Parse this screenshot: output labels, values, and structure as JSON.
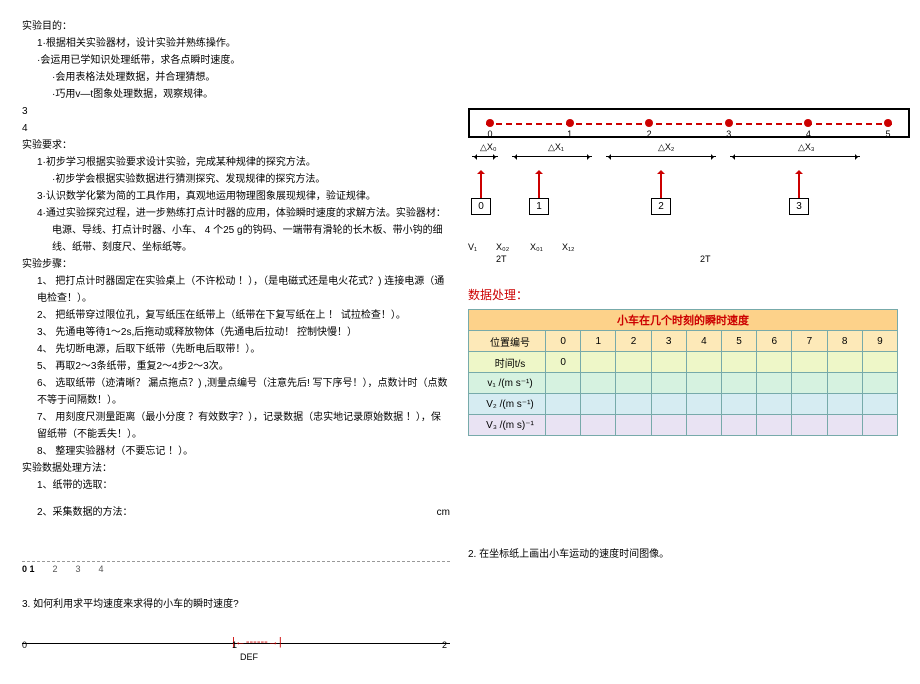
{
  "left": {
    "purpose_title": "实验目的：",
    "purpose_items": [
      "1·根据相关实验器材，设计实验并熟练操作。",
      "·会运用已学知识处理纸带，求各点瞬时速度。",
      "·会用表格法处理数据，并合理猜想。",
      "·巧用v—t图象处理数据，观察规律。"
    ],
    "nums": [
      "3",
      "4"
    ],
    "req_title": "实验要求：",
    "req_items": [
      "1·初步学习根据实验要求设计实验，完成某种规律的探究方法。",
      "·初步学会根据实验数据进行猜测探究、发现规律的探究方法。",
      "3·认识数学化繁为简的工具作用，真观地运用物理图象展现规律，验证规律。",
      "4·通过实验探究过程，进一步熟练打点计时器的应用，体验瞬时速度的求解方法。实验器材："
    ],
    "equip": "电源、导线、打点计时器、小车、 4 个25 g的钩码、一端带有滑轮的长木板、带小钩的细线、纸带、刻度尺、坐标纸等。",
    "steps_title": "实验步骤：",
    "steps": [
      "1、 把打点计时器固定在实验桌上（不许松动 ！），（是电磁式还是电火花式？) 连接电源（通电检查！）。",
      "2、 把纸带穿过限位孔，复写纸压在纸带上（纸带在下复写纸在上 ！ 试拉检查！）。",
      "3、 先通电等待1～2s,后拖动或释放物体（先通电后拉动！ 控制快慢！）",
      "4、 先切断电源，后取下纸带（先断电后取带！）。",
      "5、 再取2～3条纸带，重复2～4步2～3次。",
      "6、 选取纸带（迹清晰？ 漏点拖点？) ,测量点编号（注意先后! 写下序号！），点数计时（点数不等于间隔数！）。",
      "7、 用刻度尺测量距离（最小分度 ？有效数字？），记录数据（忠实地记录原始数据 ！），保留纸带（不能丢失！）。",
      "8、 整理实验器材（不要忘记 ！）。"
    ],
    "method_title": "实验数据处理方法：",
    "method_items": [
      "1、纸带的选取：",
      "2、采集数据的方法："
    ],
    "cm": "cm",
    "tape_marks": [
      "0 1",
      "2",
      "3",
      "4"
    ],
    "q3": "3. 如何利用求平均速度来求得的小车的瞬时速度?",
    "scale": {
      "a": "0",
      "b": "1",
      "c": "2",
      "def": "DEF"
    }
  },
  "right": {
    "track_points": [
      "0",
      "1",
      "2",
      "3",
      "4",
      "5"
    ],
    "dx_labels": [
      "△X₀",
      "△X₁",
      "△X₂",
      "△X₃"
    ],
    "pointers": [
      "0",
      "1",
      "2",
      "3"
    ],
    "sublabels": {
      "v1": "V₁",
      "x02": "X₀₂",
      "x01": "X₀₁",
      "x12": "X₁₂",
      "t2a": "2T",
      "t2b": "2T"
    },
    "data_title": "数据处理：",
    "table": {
      "header": "小车在几个时刻的瞬时速度",
      "pos": "位置编号",
      "cols": [
        "0",
        "1",
        "2",
        "3",
        "4",
        "5",
        "6",
        "7",
        "8",
        "9"
      ],
      "time": "时间t/s",
      "time0": "0",
      "v1": "v₁ /(m s⁻¹)",
      "v2": "V₂ /(m s⁻¹)",
      "v3": "V₃ /(m s)⁻¹"
    },
    "q2": "2. 在坐标纸上画出小车运动的速度时间图像。"
  }
}
